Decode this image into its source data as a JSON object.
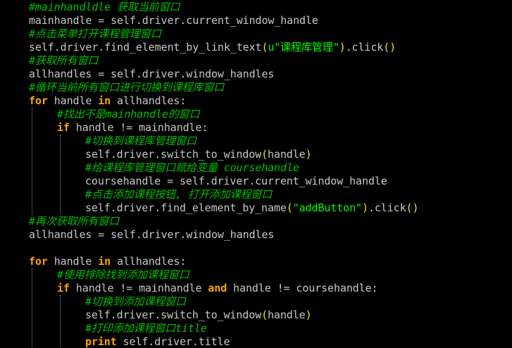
{
  "theme": {
    "background": "#000000",
    "comment": "#00c000",
    "keyword": "#ffa500",
    "identifier": "#c8c8c8",
    "paren": "#e8e800",
    "string": "#00ff00"
  },
  "code_lines": [
    {
      "indent": 1,
      "tokens": [
        {
          "t": "comment",
          "v": "#mainhandldle 获取当前窗口"
        }
      ]
    },
    {
      "indent": 1,
      "tokens": [
        {
          "t": "ident",
          "v": "mainhandle = self.driver.current_window_handle"
        }
      ]
    },
    {
      "indent": 1,
      "tokens": [
        {
          "t": "comment",
          "v": "#点击菜单打开课程管理窗口"
        }
      ]
    },
    {
      "indent": 1,
      "tokens": [
        {
          "t": "ident",
          "v": "self.driver.find_element_by_link_text"
        },
        {
          "t": "paren",
          "v": "("
        },
        {
          "t": "string",
          "v": "u\"课程库管理\""
        },
        {
          "t": "paren",
          "v": ")"
        },
        {
          "t": "ident",
          "v": ".click"
        },
        {
          "t": "paren",
          "v": "()"
        }
      ]
    },
    {
      "indent": 1,
      "tokens": [
        {
          "t": "comment",
          "v": "#获取所有窗口"
        }
      ]
    },
    {
      "indent": 1,
      "tokens": [
        {
          "t": "ident",
          "v": "allhandles = self.driver.window_handles"
        }
      ]
    },
    {
      "indent": 1,
      "tokens": [
        {
          "t": "comment",
          "v": "#循环当前所有窗口进行切换到课程库窗口"
        }
      ]
    },
    {
      "indent": 1,
      "tokens": [
        {
          "t": "keyword",
          "v": "for"
        },
        {
          "t": "ident",
          "v": " handle "
        },
        {
          "t": "keyword",
          "v": "in"
        },
        {
          "t": "ident",
          "v": " allhandles:"
        }
      ]
    },
    {
      "indent": 2,
      "tokens": [
        {
          "t": "comment",
          "v": "#找出不是mainhandle的窗口"
        }
      ]
    },
    {
      "indent": 2,
      "tokens": [
        {
          "t": "keyword",
          "v": "if"
        },
        {
          "t": "ident",
          "v": " handle != mainhandle:"
        }
      ]
    },
    {
      "indent": 3,
      "tokens": [
        {
          "t": "comment",
          "v": "#切换到课程库管理窗口"
        }
      ]
    },
    {
      "indent": 3,
      "tokens": [
        {
          "t": "ident",
          "v": "self.driver.switch_to_window"
        },
        {
          "t": "paren",
          "v": "("
        },
        {
          "t": "ident",
          "v": "handle"
        },
        {
          "t": "paren",
          "v": ")"
        }
      ]
    },
    {
      "indent": 3,
      "tokens": [
        {
          "t": "comment",
          "v": "#给课程库管理窗口赋给变量 coursehandle"
        }
      ]
    },
    {
      "indent": 3,
      "tokens": [
        {
          "t": "ident",
          "v": "coursehandle = self.driver.current_window_handle"
        }
      ]
    },
    {
      "indent": 3,
      "tokens": [
        {
          "t": "comment",
          "v": "#点击添加课程按钮, 打开添加课程窗口"
        }
      ]
    },
    {
      "indent": 3,
      "tokens": [
        {
          "t": "ident",
          "v": "self.driver.find_element_by_name"
        },
        {
          "t": "paren",
          "v": "("
        },
        {
          "t": "string",
          "v": "\"addButton\""
        },
        {
          "t": "paren",
          "v": ")"
        },
        {
          "t": "ident",
          "v": ".click"
        },
        {
          "t": "paren",
          "v": "()"
        }
      ]
    },
    {
      "indent": 1,
      "tokens": [
        {
          "t": "comment",
          "v": "#再次获取所有窗口"
        }
      ]
    },
    {
      "indent": 1,
      "tokens": [
        {
          "t": "ident",
          "v": "allhandles = self.driver.window_handles"
        }
      ]
    },
    {
      "indent": 1,
      "tokens": []
    },
    {
      "indent": 1,
      "tokens": [
        {
          "t": "keyword",
          "v": "for"
        },
        {
          "t": "ident",
          "v": " handle "
        },
        {
          "t": "keyword",
          "v": "in"
        },
        {
          "t": "ident",
          "v": " allhandles:"
        }
      ]
    },
    {
      "indent": 2,
      "tokens": [
        {
          "t": "comment",
          "v": "#使用排除找到添加课程窗口"
        }
      ]
    },
    {
      "indent": 2,
      "tokens": [
        {
          "t": "keyword",
          "v": "if"
        },
        {
          "t": "ident",
          "v": " handle != mainhandle "
        },
        {
          "t": "keyword",
          "v": "and"
        },
        {
          "t": "ident",
          "v": " handle != coursehandle:"
        }
      ]
    },
    {
      "indent": 3,
      "tokens": [
        {
          "t": "comment",
          "v": "#切换到添加课程窗口"
        }
      ]
    },
    {
      "indent": 3,
      "tokens": [
        {
          "t": "ident",
          "v": "self.driver.switch_to_window"
        },
        {
          "t": "paren",
          "v": "("
        },
        {
          "t": "ident",
          "v": "handle"
        },
        {
          "t": "paren",
          "v": ")"
        }
      ]
    },
    {
      "indent": 3,
      "tokens": [
        {
          "t": "comment",
          "v": "#打印添加课程窗口title"
        }
      ]
    },
    {
      "indent": 3,
      "tokens": [
        {
          "t": "keyword",
          "v": "print"
        },
        {
          "t": "ident",
          "v": " self.driver.title"
        }
      ]
    }
  ]
}
